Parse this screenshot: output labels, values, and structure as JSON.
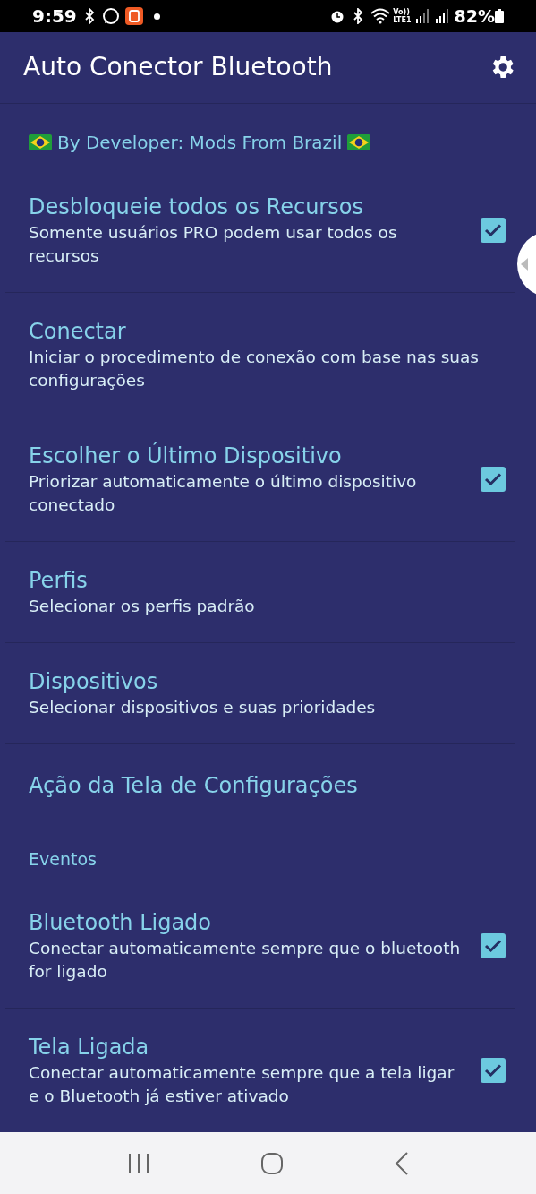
{
  "status_bar": {
    "time": "9:59",
    "volte_top": "Vo))",
    "volte_bottom": "LTE1",
    "battery": "82%"
  },
  "app_bar": {
    "title": "Auto Conector Bluetooth"
  },
  "items": [
    {
      "kind": "banner",
      "title": "By Developer: Mods From Brazil"
    },
    {
      "kind": "checkbox",
      "title": "Desbloqueie todos os Recursos",
      "summary": "Somente usuários PRO podem usar todos os recursos",
      "checked": true
    },
    {
      "kind": "plain",
      "title": "Conectar",
      "summary": "Iniciar o procedimento de conexão com base nas suas configurações"
    },
    {
      "kind": "checkbox",
      "title": "Escolher o Último Dispositivo",
      "summary": "Priorizar automaticamente o último dispositivo conectado",
      "checked": true
    },
    {
      "kind": "plain",
      "title": "Perfis",
      "summary": "Selecionar os perfis padrão"
    },
    {
      "kind": "plain",
      "title": "Dispositivos",
      "summary": "Selecionar dispositivos e suas prioridades"
    },
    {
      "kind": "plain",
      "title": "Ação da Tela de Configurações",
      "divider": false
    },
    {
      "kind": "category",
      "title": "Eventos"
    },
    {
      "kind": "checkbox",
      "title": "Bluetooth Ligado",
      "summary": "Conectar automaticamente sempre que o bluetooth for ligado",
      "checked": true
    },
    {
      "kind": "checkbox",
      "title": "Tela Ligada",
      "summary": "Conectar automaticamente sempre que a tela ligar e o Bluetooth já estiver ativado",
      "checked": true,
      "divider": false
    }
  ]
}
